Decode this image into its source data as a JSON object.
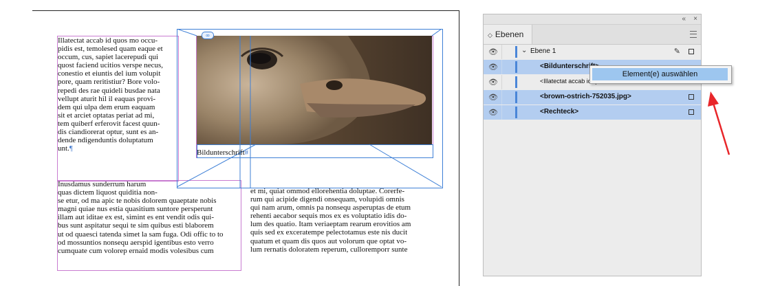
{
  "document": {
    "left_column_top_lines": [
      "Illatectat accab id quos mo occu-",
      "pidis est, temolesed quam eaque et",
      "occum, cus, sapiet lacerepudi qui",
      "quost faciend ucitios verspe necus,",
      "conestio et eiuntis del ium volupit",
      "pore, quam reritistiur? Bore volo-",
      "repedi des rae quideli busdae nata",
      "vellupt aturit hil il eaquas provi-",
      "dem qui ulpa dem erum eaquam",
      "sit et arciet optatas periat ad mi,",
      "tem quiberf erferovit facest quun-",
      "dis ciandiorerat optur, sunt es an-",
      "dende ndigenduntis doluptatum",
      "unt."
    ],
    "left_column_bottom_lines": [
      "Inusdamus sunderrum harum",
      "quas dictem liquost quiditia non-",
      "se etur, od ma apic te nobis dolorem quaeptate nobis",
      "magni quiae nus estia quasitium suntore persperunt",
      "illam aut iditae ex est, simint es ent vendit odis qui-",
      "bus sunt aspitatur sequi te sim quibus esti blaborem",
      "ut od quaesci tatenda simet la sam fuga. Odi offic to to",
      "od mossuntios nonsequ aerspid igentibus esto verro",
      "cumquate cum volorep ernaid modis volesibus cum"
    ],
    "right_column_lines": [
      "et mi, quiat ommod ellorehentia doluptae. Corerfe-",
      "rum qui acipide digendi onsequam, volupidi omnis",
      "qui nam arum, omnis pa nonsequ asperuptas de etum",
      "rehenti aecabor sequis mos ex es voluptatio idis do-",
      "lum des quatio. Itam veriaeptam rearum erovitios am",
      "quis sed ex exceratempe pelectotamus este nis ducit",
      "quatum et quam dis quos aut volorum que optat vo-",
      "lum rernatis doloratem reperum, culloremporr sunte"
    ],
    "caption": "Bildunterschrift",
    "pilcrow": "¶",
    "hash_mark": "#",
    "link_badge": "∞"
  },
  "layers_panel": {
    "collapse_icon": "«",
    "close_icon": "×",
    "tab_arrow": "◇",
    "tab_label": "Ebenen",
    "layer_name": "Ebene 1",
    "rows": [
      {
        "label": "<Bildunterschrift>",
        "bold": true,
        "selected": true
      },
      {
        "label": "<Illatectat accab id quos mo occum>",
        "bold": false,
        "selected": false
      },
      {
        "label": "<brown-ostrich-752035.jpg>",
        "bold": true,
        "selected": true
      },
      {
        "label": "<Rechteck>",
        "bold": true,
        "selected": true
      }
    ]
  },
  "context_menu": {
    "item_label": "Element(e) auswählen"
  },
  "annotation": {
    "arrow_color": "#e8262a"
  }
}
